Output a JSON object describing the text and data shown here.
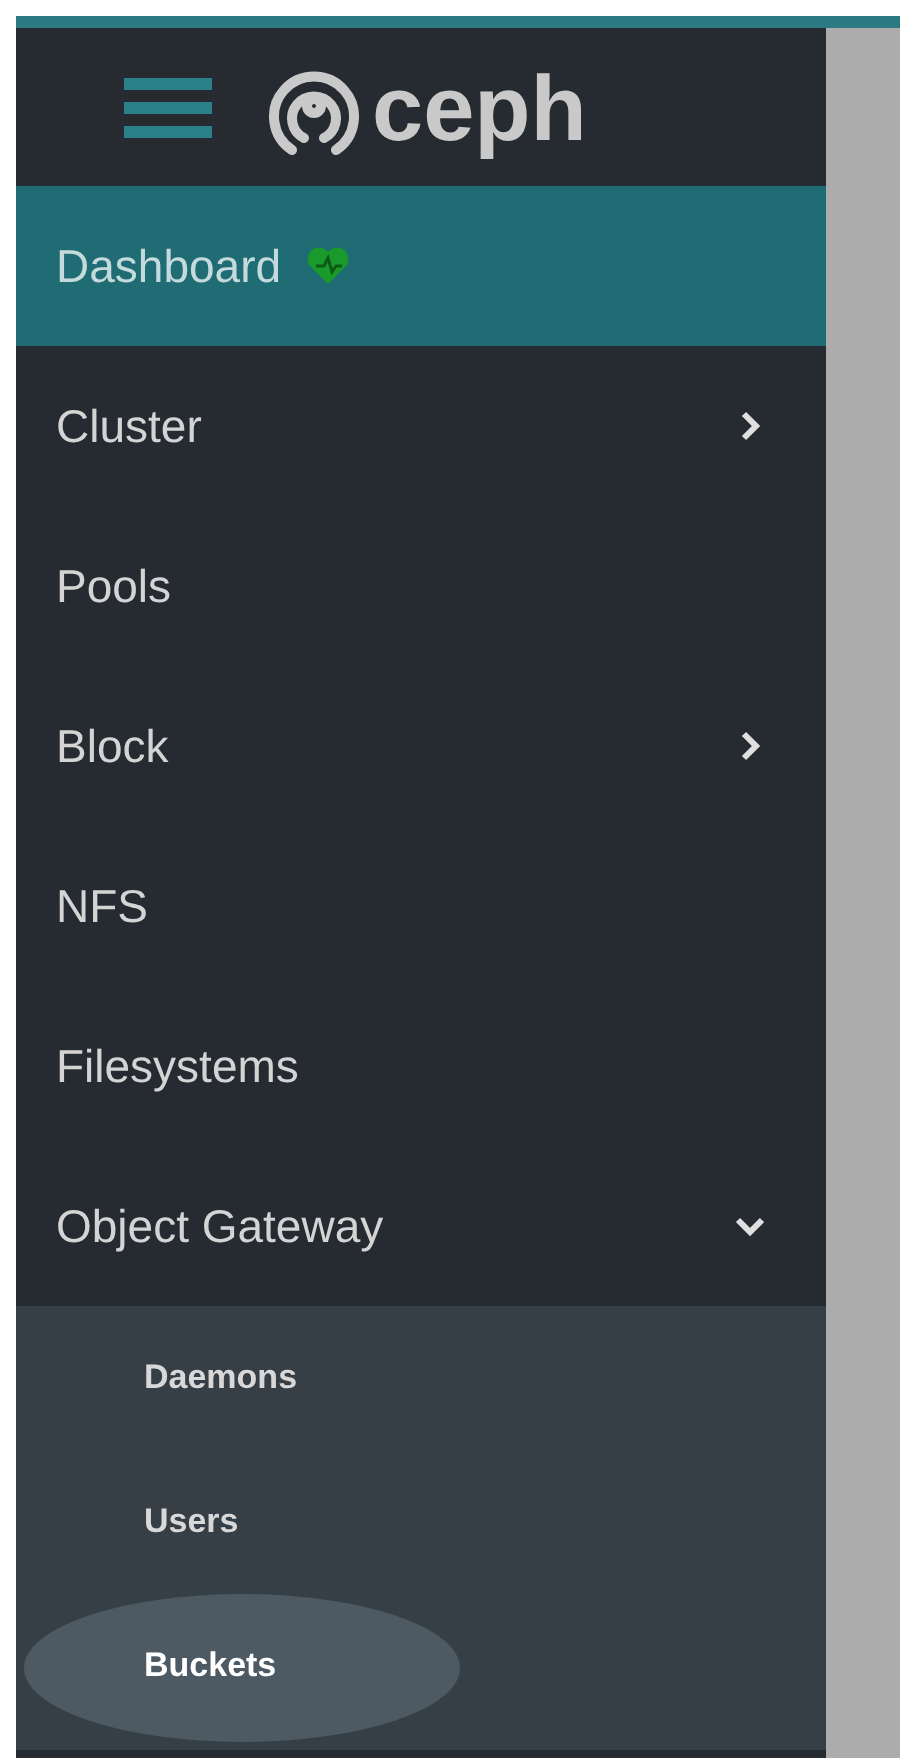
{
  "header": {
    "brand": "ceph"
  },
  "nav": [
    {
      "label": "Dashboard",
      "kind": "link",
      "selected": true,
      "health_icon": true
    },
    {
      "label": "Cluster",
      "kind": "group",
      "selected": false,
      "expanded": false
    },
    {
      "label": "Pools",
      "kind": "link",
      "selected": false
    },
    {
      "label": "Block",
      "kind": "group",
      "selected": false,
      "expanded": false
    },
    {
      "label": "NFS",
      "kind": "link",
      "selected": false
    },
    {
      "label": "Filesystems",
      "kind": "link",
      "selected": false
    },
    {
      "label": "Object Gateway",
      "kind": "group",
      "selected": false,
      "expanded": true,
      "children": [
        {
          "label": "Daemons",
          "selected": false
        },
        {
          "label": "Users",
          "selected": false
        },
        {
          "label": "Buckets",
          "selected": true
        }
      ]
    }
  ]
}
